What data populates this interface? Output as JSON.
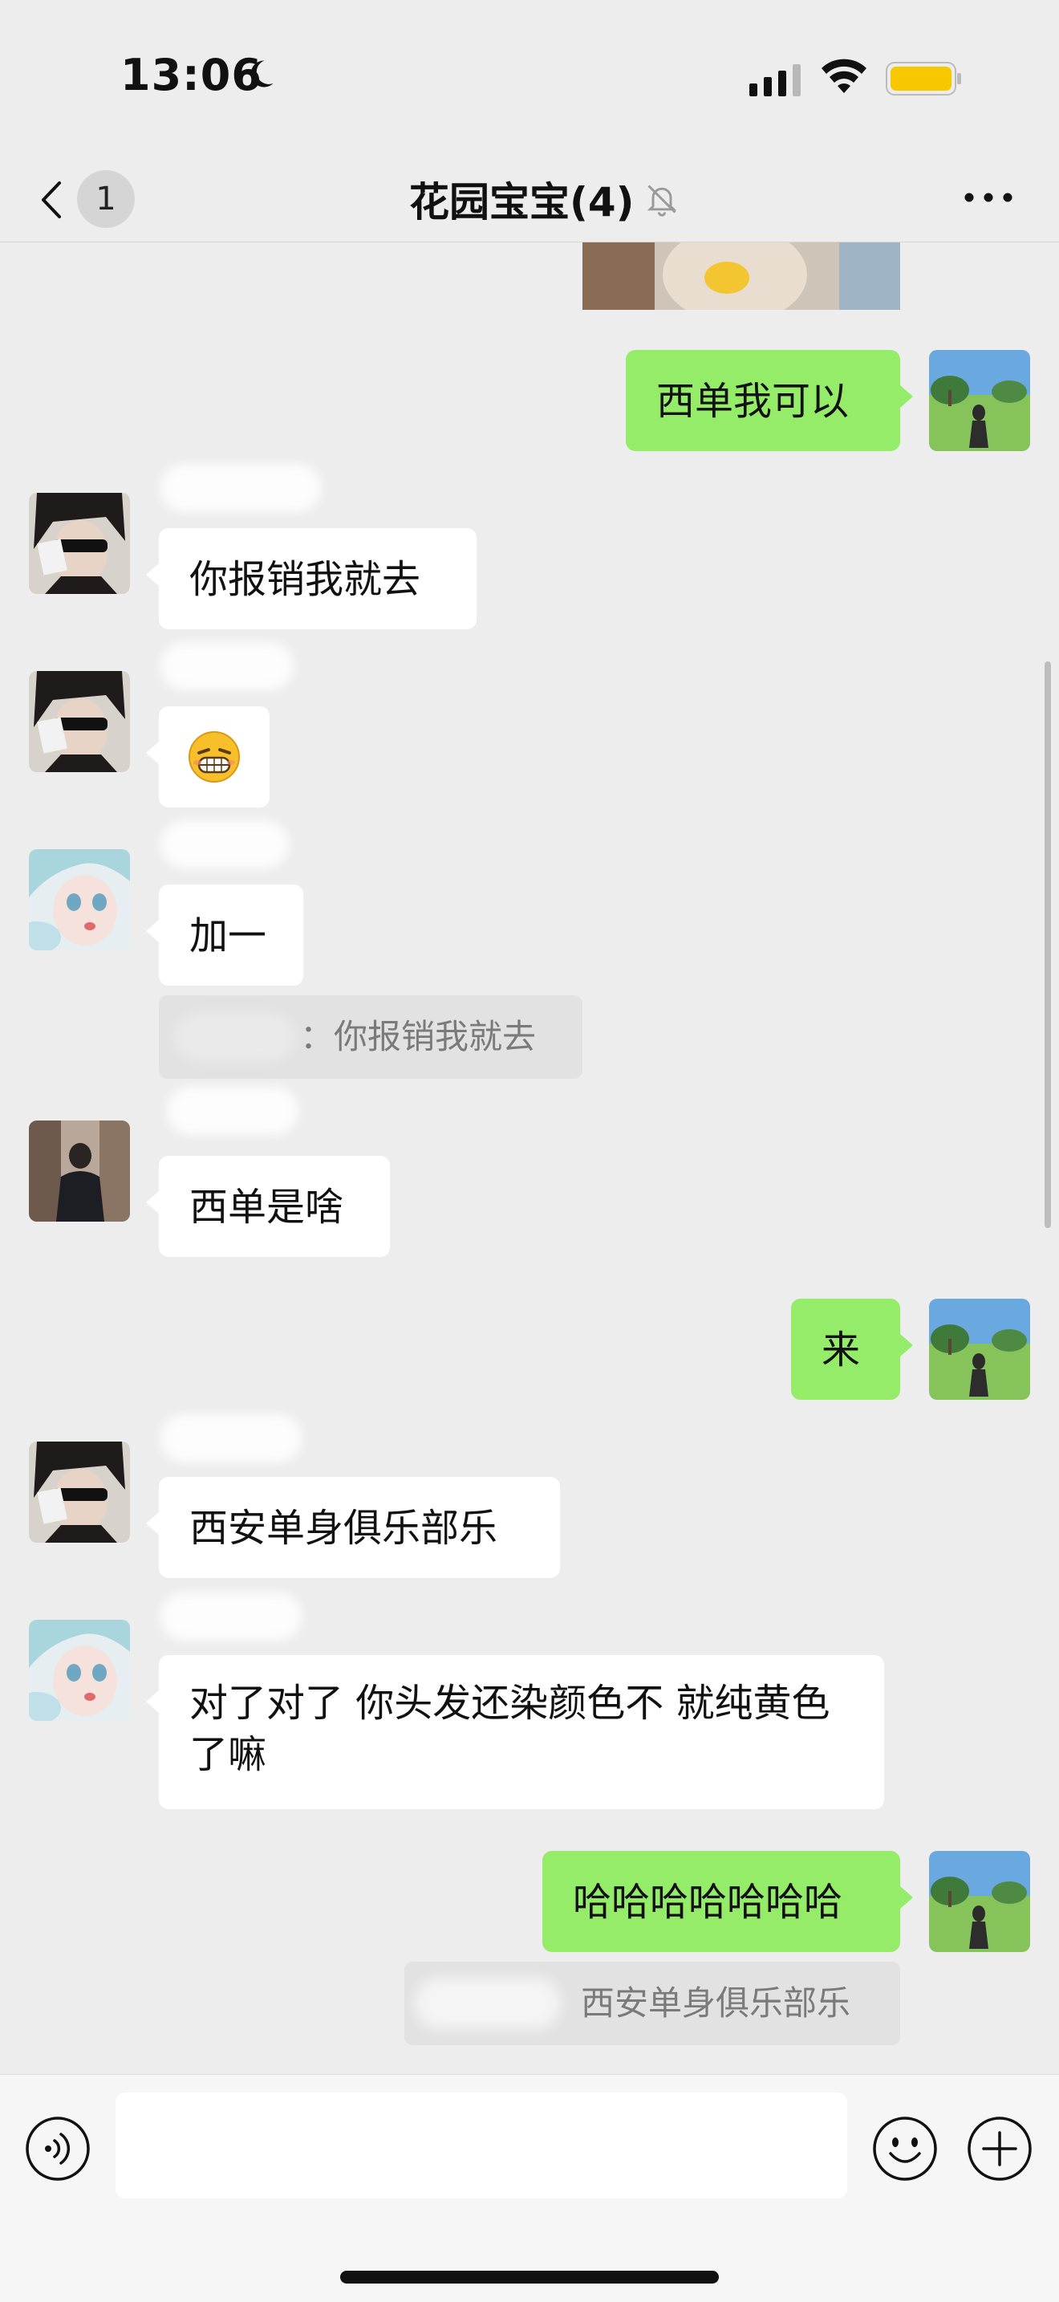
{
  "status_bar": {
    "time": "13:06"
  },
  "header": {
    "back_count": "1",
    "title": "花园宝宝(4)"
  },
  "messages": [
    {
      "text": "西单我可以"
    },
    {
      "text": "你报销我就去"
    },
    {
      "text": "😁"
    },
    {
      "text": "加一"
    },
    {
      "quote": "：你报销我就去"
    },
    {
      "text": "西单是啥"
    },
    {
      "text": "来"
    },
    {
      "text": "西安单身俱乐部乐"
    },
    {
      "text": "对了对了 你头发还染颜色不 就纯黄色了嘛"
    },
    {
      "text": "哈哈哈哈哈哈哈"
    },
    {
      "quote": "西安单身俱乐部乐"
    }
  ],
  "colors": {
    "outgoing_bubble": "#95ec69",
    "incoming_bubble": "#ffffff",
    "background": "#ededed"
  }
}
